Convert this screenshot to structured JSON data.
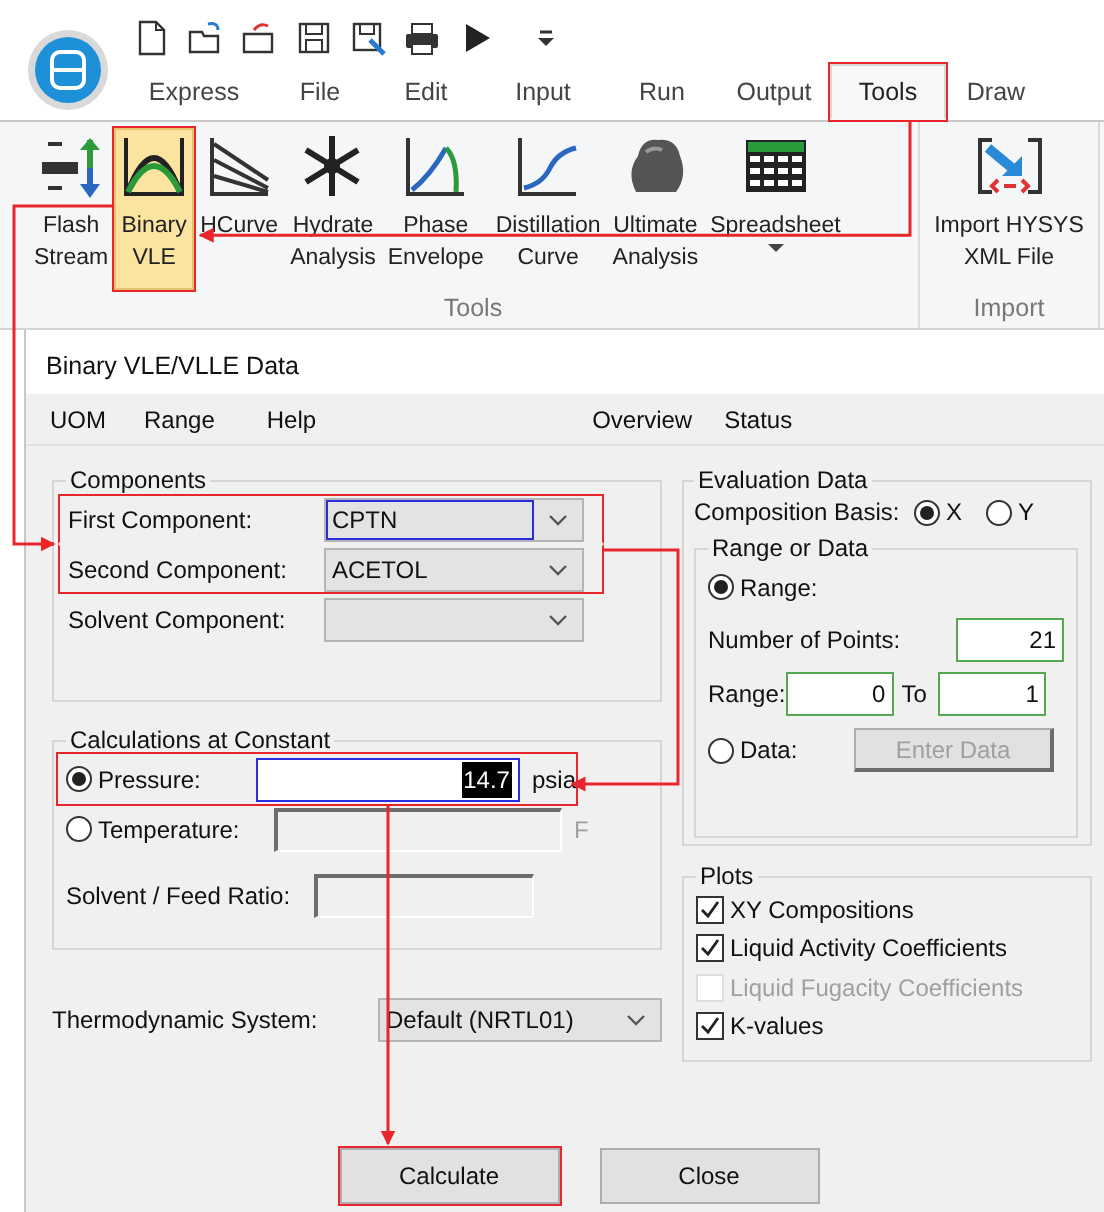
{
  "ribbon_tabs": [
    {
      "label": "Express",
      "selected": false,
      "annotated": false
    },
    {
      "label": "File",
      "selected": false,
      "annotated": false
    },
    {
      "label": "Edit",
      "selected": false,
      "annotated": false
    },
    {
      "label": "Input",
      "selected": false,
      "annotated": false
    },
    {
      "label": "Run",
      "selected": false,
      "annotated": false
    },
    {
      "label": "Output",
      "selected": false,
      "annotated": false
    },
    {
      "label": "Tools",
      "selected": true,
      "annotated": true
    },
    {
      "label": "Draw",
      "selected": false,
      "annotated": false
    }
  ],
  "ribbon_groups": [
    {
      "label": "Tools",
      "buttons": [
        {
          "lines": [
            "Flash",
            "Stream"
          ],
          "selected": false,
          "annotated": false
        },
        {
          "lines": [
            "Binary",
            "VLE"
          ],
          "selected": true,
          "annotated": true
        },
        {
          "lines": [
            "HCurve"
          ],
          "selected": false,
          "annotated": false
        },
        {
          "lines": [
            "Hydrate",
            "Analysis"
          ],
          "selected": false,
          "annotated": false
        },
        {
          "lines": [
            "Phase",
            "Envelope"
          ],
          "selected": false,
          "annotated": false
        },
        {
          "lines": [
            "Distillation",
            "Curve"
          ],
          "selected": false,
          "annotated": false
        },
        {
          "lines": [
            "Ultimate",
            "Analysis"
          ],
          "selected": false,
          "annotated": false
        },
        {
          "lines": [
            "Spreadsheet"
          ],
          "selected": false,
          "annotated": false,
          "has_menu": true
        }
      ]
    },
    {
      "label": "Import",
      "buttons": [
        {
          "lines": [
            "Import HYSYS",
            "XML File"
          ],
          "selected": false,
          "annotated": false
        }
      ]
    }
  ],
  "dialog": {
    "title": "Binary VLE/VLLE Data",
    "menu": [
      "UOM",
      "Range",
      "Help"
    ],
    "menu_right": [
      "Overview",
      "Status"
    ],
    "components": {
      "title": "Components",
      "rows": [
        {
          "label": "First Component:",
          "value": "CPTN",
          "focused": true,
          "annotated": true
        },
        {
          "label": "Second Component:",
          "value": "ACETOL",
          "focused": false,
          "annotated": true
        },
        {
          "label": "Solvent Component:",
          "value": "",
          "focused": false,
          "annotated": false
        }
      ]
    },
    "calculations": {
      "title": "Calculations at Constant",
      "options": [
        {
          "label": "Pressure:",
          "selected": true,
          "disabled": false,
          "value": "14.7",
          "unit": "psia",
          "focused": true,
          "annotated": true
        },
        {
          "label": "Temperature:",
          "selected": false,
          "disabled": true,
          "unit": "F",
          "focused": false,
          "annotated": false
        }
      ],
      "ratio_label": "Solvent / Feed Ratio:"
    },
    "thermo": {
      "label": "Thermodynamic System:",
      "value": "Default (NRTL01)"
    },
    "evaluation": {
      "title": "Evaluation Data",
      "basis_label": "Composition Basis:",
      "basis_options": [
        {
          "label": "X",
          "selected": true
        },
        {
          "label": "Y",
          "selected": false
        }
      ],
      "range_or_data": {
        "title": "Range or Data",
        "range_option": {
          "label": "Range:",
          "selected": true
        },
        "points_label": "Number of Points:",
        "points": "21",
        "range_label": "Range:",
        "range_from": "0",
        "to_label": "To",
        "range_to": "1",
        "data_option": {
          "label": "Data:",
          "selected": false
        },
        "enter_data": {
          "label": "Enter Data",
          "disabled": true
        }
      }
    },
    "plots": {
      "title": "Plots",
      "items": [
        {
          "label": "XY Compositions",
          "checked": true,
          "disabled": false
        },
        {
          "label": "Liquid Activity Coefficients",
          "checked": true,
          "disabled": false
        },
        {
          "label": "Liquid Fugacity Coefficients",
          "checked": false,
          "disabled": true
        },
        {
          "label": "K-values",
          "checked": true,
          "disabled": false
        }
      ]
    },
    "buttons": [
      {
        "label": "Calculate",
        "annotated": true
      },
      {
        "label": "Close",
        "annotated": false
      }
    ]
  }
}
